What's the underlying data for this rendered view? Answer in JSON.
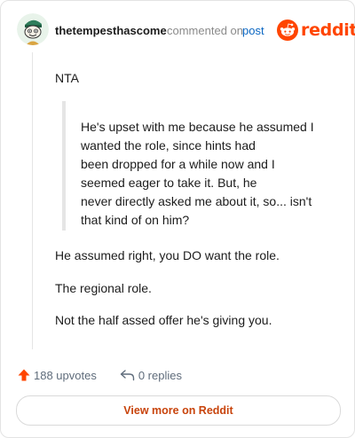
{
  "header": {
    "username": "thetempesthascome",
    "meta_text": "commented on",
    "post_link": "post",
    "brand": "reddit"
  },
  "comment": {
    "intro": "NTA",
    "quote_lines": [
      "He's upset with me because he assumed I",
      "wanted the role, since hints had",
      "been dropped for a while now and I",
      "seemed eager to take it. But, he",
      "never directly asked me about it, so... isn't",
      "that kind of on him?"
    ],
    "paragraphs": [
      "He assumed right, you DO want the role.",
      "The regional role.",
      "Not the half assed offer he's giving you."
    ]
  },
  "footer": {
    "upvotes": "188 upvotes",
    "replies": "0 replies",
    "view_more": "View more on Reddit"
  },
  "colors": {
    "accent": "#ff4500",
    "link": "#0a66c2",
    "cta_text": "#c8440c",
    "muted": "#5f6c7b"
  },
  "icons": {
    "avatar": "snoo-avatar-icon",
    "brand": "reddit-logo-icon",
    "upvote": "upvote-arrow-icon",
    "reply": "reply-arrow-icon"
  }
}
